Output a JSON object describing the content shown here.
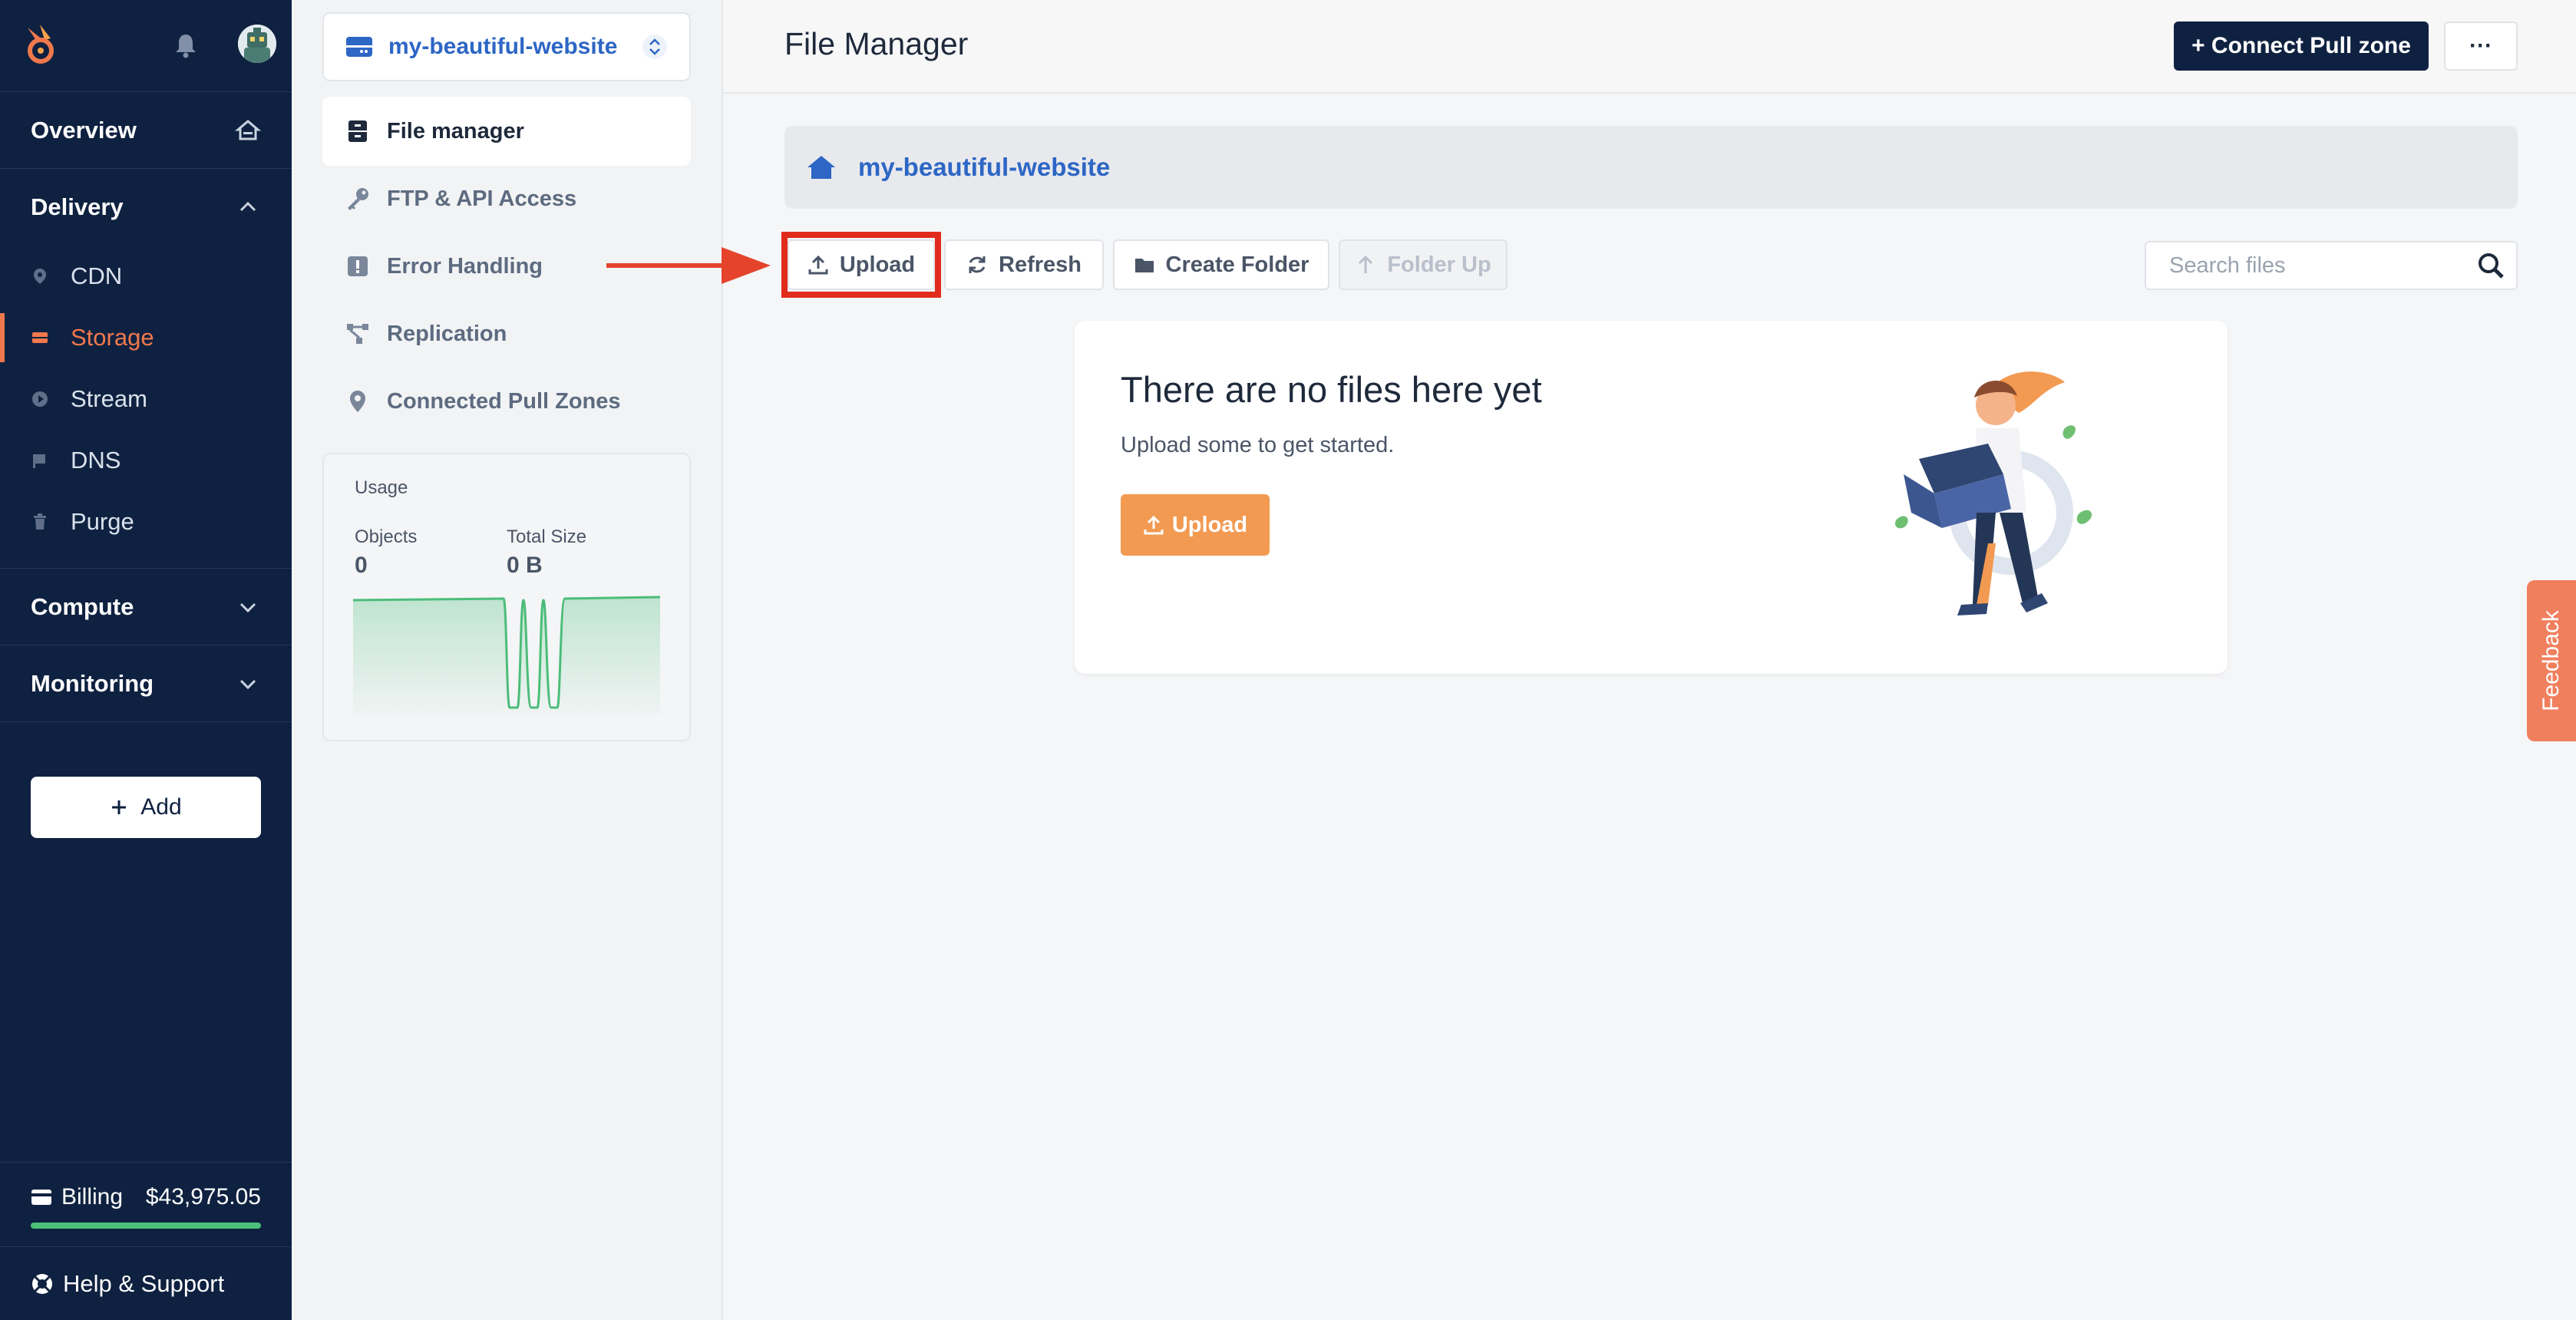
{
  "nav": {
    "overview": "Overview",
    "delivery": "Delivery",
    "items": [
      {
        "label": "CDN",
        "icon": "location-pin-icon"
      },
      {
        "label": "Storage",
        "icon": "storage-icon"
      },
      {
        "label": "Stream",
        "icon": "play-circle-icon"
      },
      {
        "label": "DNS",
        "icon": "flag-icon"
      },
      {
        "label": "Purge",
        "icon": "trash-icon"
      }
    ],
    "compute": "Compute",
    "monitoring": "Monitoring",
    "add_label": "Add",
    "billing_label": "Billing",
    "billing_amount": "$43,975.05",
    "help_label": "Help & Support",
    "accent": "#f0784d"
  },
  "panel": {
    "zone_name": "my-beautiful-website",
    "items": [
      {
        "label": "File manager"
      },
      {
        "label": "FTP & API Access"
      },
      {
        "label": "Error Handling"
      },
      {
        "label": "Replication"
      },
      {
        "label": "Connected Pull Zones"
      }
    ],
    "usage": {
      "title": "Usage",
      "objects_label": "Objects",
      "objects_value": "0",
      "size_label": "Total Size",
      "size_value": "0 B"
    }
  },
  "header": {
    "title": "File Manager",
    "connect_label": "+ Connect Pull zone",
    "more_label": "···"
  },
  "breadcrumb": "my-beautiful-website",
  "toolbar": {
    "upload": "Upload",
    "refresh": "Refresh",
    "create_folder": "Create Folder",
    "folder_up": "Folder Up",
    "search_placeholder": "Search files"
  },
  "empty": {
    "title": "There are no files here yet",
    "subtitle": "Upload some to get started.",
    "upload": "Upload"
  },
  "feedback": "Feedback"
}
